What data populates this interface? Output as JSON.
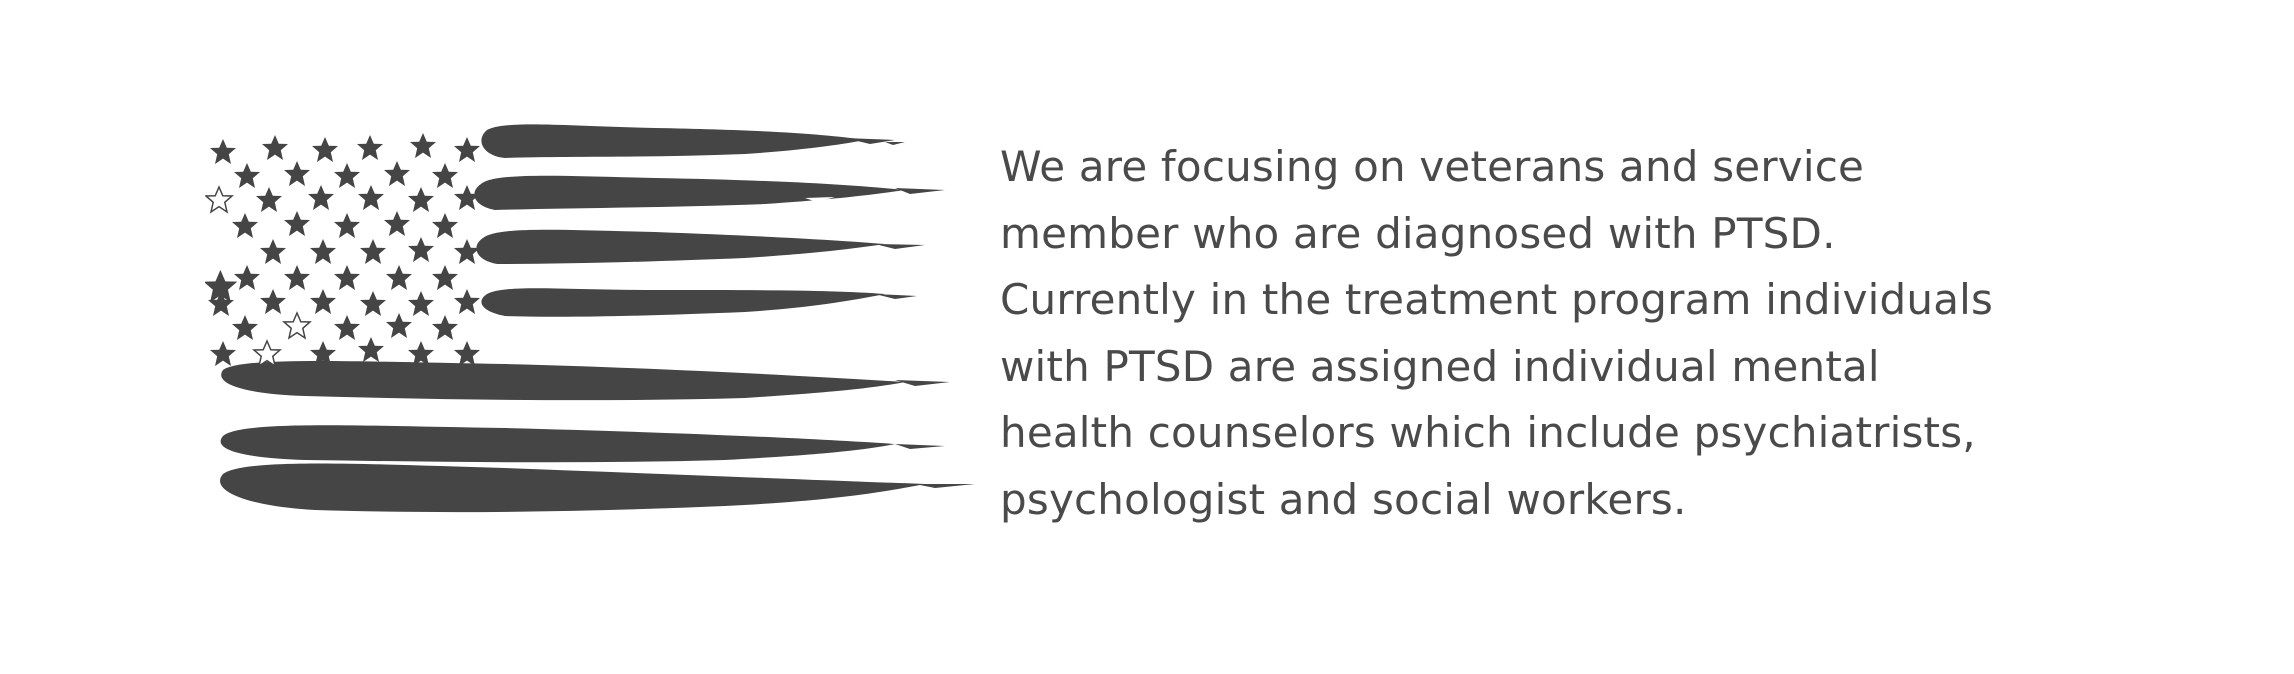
{
  "section": {
    "image": {
      "alt_icon": "distressed-american-flag-icon",
      "ink_color": "#454545"
    },
    "description": {
      "lines": [
        "We are focusing on veterans and service",
        "member who are diagnosed with PTSD.",
        "Currently in the treatment program individuals",
        "with PTSD are assigned individual mental",
        "health counselors which include psychiatrists,",
        "psychologist and social workers."
      ]
    }
  }
}
